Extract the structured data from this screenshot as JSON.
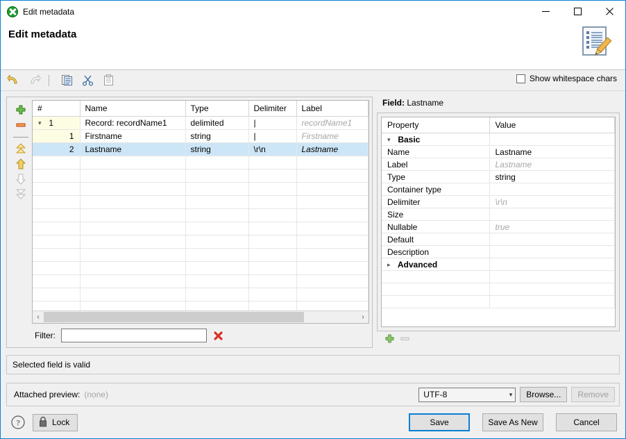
{
  "window": {
    "title": "Edit metadata",
    "icon": "clover-green-icon",
    "minimize": "─",
    "maximize": "□",
    "close": "✕"
  },
  "header": {
    "heading": "Edit metadata",
    "icon": "metadata-edit-icon"
  },
  "toolbar": {
    "items": [
      {
        "name": "undo-icon",
        "enabled": true
      },
      {
        "name": "redo-icon",
        "enabled": false
      },
      {
        "name": "copy-icon",
        "enabled": true
      },
      {
        "name": "cut-icon",
        "enabled": true
      },
      {
        "name": "paste-icon",
        "enabled": false
      }
    ],
    "whitespace_checkbox": {
      "label": "Show whitespace chars",
      "checked": false
    }
  },
  "field_tools": [
    {
      "name": "add-field-button",
      "glyph": "plus",
      "enabled": true
    },
    {
      "name": "remove-field-button",
      "glyph": "minus",
      "enabled": true
    },
    {
      "name": "move-top-button",
      "glyph": "double-up",
      "enabled": true
    },
    {
      "name": "move-up-button",
      "glyph": "up",
      "enabled": true
    },
    {
      "name": "move-down-button",
      "glyph": "down",
      "enabled": false
    },
    {
      "name": "move-bottom-button",
      "glyph": "double-down",
      "enabled": false
    }
  ],
  "table": {
    "columns": [
      "#",
      "Name",
      "Type",
      "Delimiter",
      "Label"
    ],
    "rows": [
      {
        "num": "1",
        "name": "Record: recordName1",
        "type": "delimited",
        "delimiter": "|",
        "label": "recordName1",
        "is_record": true,
        "expanded": true,
        "selected": false
      },
      {
        "num": "1",
        "name": "Firstname",
        "type": "string",
        "delimiter": "|",
        "label": "Firstname",
        "is_record": false,
        "selected": false
      },
      {
        "num": "2",
        "name": "Lastname",
        "type": "string",
        "delimiter": "\\r\\n",
        "label": "Lastname",
        "is_record": false,
        "selected": true
      }
    ],
    "empty_row_count": 12,
    "scroll_left_arrow": "‹",
    "scroll_right_arrow": "›"
  },
  "filter": {
    "label": "Filter:",
    "value": "",
    "clear_icon": "red-x-icon"
  },
  "field_panel": {
    "title_prefix": "Field:",
    "title_value": "Lastname",
    "columns": [
      "Property",
      "Value"
    ],
    "rows": [
      {
        "property": "Basic",
        "value": "",
        "kind": "group",
        "expanded": true
      },
      {
        "property": "Name",
        "value": "Lastname",
        "kind": "child",
        "muted": false
      },
      {
        "property": "Label",
        "value": "Lastname",
        "kind": "child",
        "muted": true
      },
      {
        "property": "Type",
        "value": "string",
        "kind": "child",
        "muted": false
      },
      {
        "property": "Container type",
        "value": "",
        "kind": "child",
        "muted": false
      },
      {
        "property": "Delimiter",
        "value": "\\r\\n",
        "kind": "child",
        "muted": true
      },
      {
        "property": "Size",
        "value": "",
        "kind": "child",
        "muted": false
      },
      {
        "property": "Nullable",
        "value": "true",
        "kind": "child",
        "muted": true
      },
      {
        "property": "Default",
        "value": "",
        "kind": "child",
        "muted": false
      },
      {
        "property": "Description",
        "value": "",
        "kind": "child",
        "muted": false
      },
      {
        "property": "Advanced",
        "value": "",
        "kind": "group",
        "expanded": false
      }
    ],
    "empty_row_count": 3,
    "tools": [
      {
        "name": "add-property-button",
        "glyph": "plus",
        "enabled": true
      },
      {
        "name": "remove-property-button",
        "glyph": "minus",
        "enabled": false
      }
    ]
  },
  "status": {
    "message": "Selected field is valid"
  },
  "preview": {
    "label": "Attached preview:",
    "value": "(none)",
    "encoding": "UTF-8",
    "browse_label": "Browse...",
    "remove_label": "Remove",
    "remove_enabled": false
  },
  "footer": {
    "help_icon": "help-question-icon",
    "lock_label": "Lock",
    "lock_icon": "padlock-icon",
    "save_label": "Save",
    "save_as_new_label": "Save As New",
    "cancel_label": "Cancel"
  },
  "colors": {
    "window_border": "#0a7fd4",
    "selection": "#cde6f7",
    "number_column": "#fdfde4",
    "muted_text": "#a6a6a6",
    "accent_green": "#1f9d2f",
    "accent_red": "#e03131",
    "chrome": "#f0f0f0"
  }
}
